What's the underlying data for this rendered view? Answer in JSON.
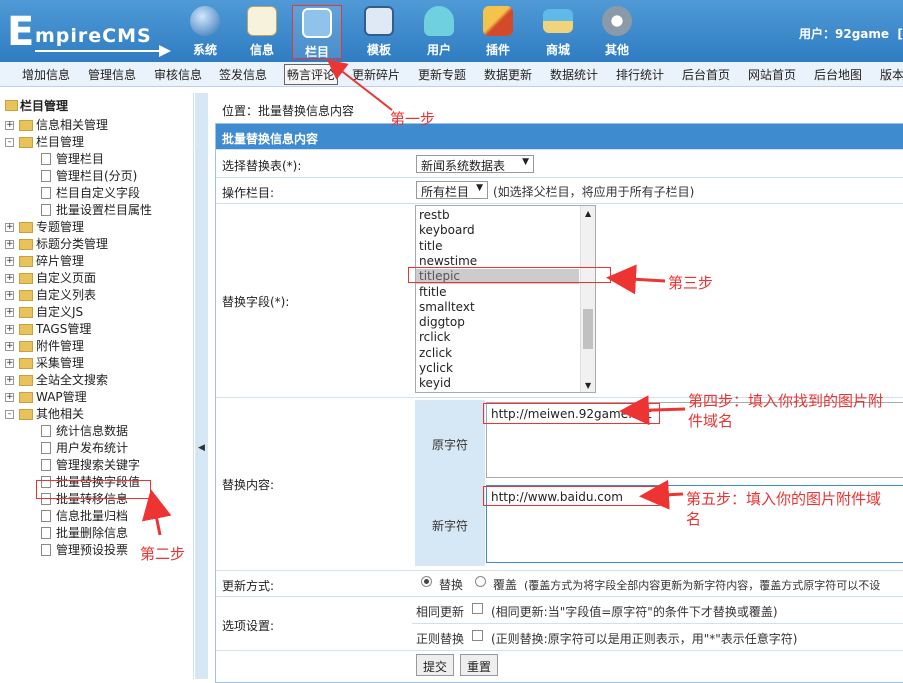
{
  "header": {
    "logo_first": "E",
    "logo_rest": "mpireCMS",
    "nav": [
      {
        "label": "系统",
        "icon": "globe-icon"
      },
      {
        "label": "信息",
        "icon": "document-icon"
      },
      {
        "label": "栏目",
        "icon": "folder-icon"
      },
      {
        "label": "模板",
        "icon": "template-window-icon"
      },
      {
        "label": "用户",
        "icon": "user-icon"
      },
      {
        "label": "插件",
        "icon": "plugin-tools-icon"
      },
      {
        "label": "商城",
        "icon": "shop-card-icon"
      },
      {
        "label": "其他",
        "icon": "gear-icon"
      }
    ],
    "user_label": "用户：92game",
    "user_trailing": "[退"
  },
  "menubar": [
    "增加信息",
    "管理信息",
    "审核信息",
    "签发信息",
    "畅言评论",
    "更新碎片",
    "更新专题",
    "数据更新",
    "数据统计",
    "排行统计",
    "后台首页",
    "网站首页",
    "后台地图",
    "版本"
  ],
  "sidebar": {
    "root": "栏目管理",
    "items": [
      {
        "label": "信息相关管理",
        "type": "folder",
        "pm": "+"
      },
      {
        "label": "栏目管理",
        "type": "folder",
        "pm": "-"
      },
      {
        "label": "管理栏目",
        "type": "page"
      },
      {
        "label": "管理栏目(分页)",
        "type": "page"
      },
      {
        "label": "栏目自定义字段",
        "type": "page"
      },
      {
        "label": "批量设置栏目属性",
        "type": "page"
      },
      {
        "label": "专题管理",
        "type": "folder",
        "pm": "+"
      },
      {
        "label": "标题分类管理",
        "type": "folder",
        "pm": "+"
      },
      {
        "label": "碎片管理",
        "type": "folder",
        "pm": "+"
      },
      {
        "label": "自定义页面",
        "type": "folder",
        "pm": "+"
      },
      {
        "label": "自定义列表",
        "type": "folder",
        "pm": "+"
      },
      {
        "label": "自定义JS",
        "type": "folder",
        "pm": "+"
      },
      {
        "label": "TAGS管理",
        "type": "folder",
        "pm": "+"
      },
      {
        "label": "附件管理",
        "type": "folder",
        "pm": "+"
      },
      {
        "label": "采集管理",
        "type": "folder",
        "pm": "+"
      },
      {
        "label": "全站全文搜索",
        "type": "folder",
        "pm": "+"
      },
      {
        "label": "WAP管理",
        "type": "folder",
        "pm": "+"
      },
      {
        "label": "其他相关",
        "type": "folder",
        "pm": "-"
      },
      {
        "label": "统计信息数据",
        "type": "page"
      },
      {
        "label": "用户发布统计",
        "type": "page"
      },
      {
        "label": "管理搜索关键字",
        "type": "page"
      },
      {
        "label": "批量替换字段值",
        "type": "page"
      },
      {
        "label": "批量转移信息",
        "type": "page"
      },
      {
        "label": "信息批量归档",
        "type": "page"
      },
      {
        "label": "批量删除信息",
        "type": "page"
      },
      {
        "label": "管理预设投票",
        "type": "page"
      }
    ],
    "collapse_glyph": "◀"
  },
  "main": {
    "breadcrumb": "位置：批量替换信息内容",
    "panel_title": "批量替换信息内容",
    "table_label": "选择替换表(*):",
    "table_value": "新闻系统数据表",
    "column_label": "操作栏目:",
    "column_value": "所有栏目",
    "column_note": "(如选择父栏目，将应用于所有子栏目)",
    "field_label": "替换字段(*):",
    "fields": [
      "restb",
      "keyboard",
      "title",
      "newstime",
      "titlepic",
      "ftitle",
      "smalltext",
      "diggtop",
      "rclick",
      "zclick",
      "yclick",
      "keyid"
    ],
    "selected_field": "titlepic",
    "content_label": "替换内容:",
    "old_label": "原字符",
    "old_value": "http://meiwen.92game.net",
    "new_label": "新字符",
    "new_value": "http://www.baidu.com",
    "mode_label": "更新方式:",
    "mode_replace": "替换",
    "mode_cover": "覆盖",
    "mode_note": "(覆盖方式为将字段全部内容更新为新字符内容，覆盖方式原字符可以不设",
    "options_label": "选项设置:",
    "opt_same": "相同更新",
    "opt_same_note": "(相同更新:当\"字段值=原字符\"的条件下才替换或覆盖)",
    "opt_regex": "正则替换",
    "opt_regex_note": "(正则替换:原字符可以是用正则表示，用\"*\"表示任意字符)",
    "submit": "提交",
    "reset": "重置"
  },
  "annotations": {
    "step1": "第一步",
    "step2": "第二步",
    "step3": "第三步",
    "step4_l1": "第四步：填入你找到的图片附",
    "step4_l2": "件域名",
    "step5_l1": "第五步：填入你的图片附件域",
    "step5_l2": "名"
  },
  "colors": {
    "header": "#3a86c8",
    "annotation": "#e33333",
    "panel_head": "#3f8bd0"
  }
}
